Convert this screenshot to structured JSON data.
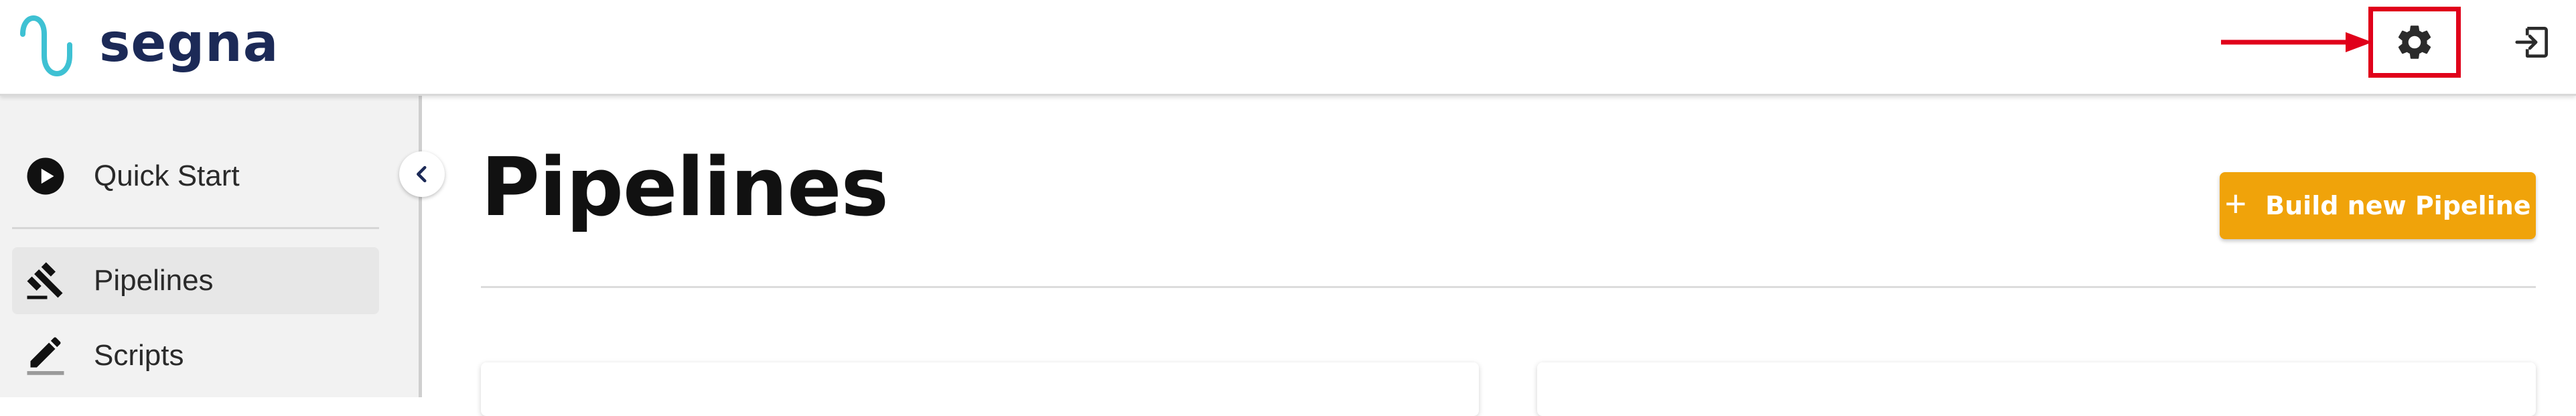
{
  "header": {
    "logo_text": "segna",
    "brand_color": "#1c2a57",
    "logo_accent_color": "#3ec1d3",
    "settings_icon": "gear-icon",
    "logout_icon": "logout-icon",
    "annotation_color": "#e0001a"
  },
  "sidebar": {
    "collapse_icon": "chevron-left-icon",
    "items": [
      {
        "label": "Quick Start",
        "icon": "play-circle-icon",
        "active": false
      },
      {
        "label": "Pipelines",
        "icon": "gavel-icon",
        "active": true
      },
      {
        "label": "Scripts",
        "icon": "pencil-icon",
        "active": false
      }
    ]
  },
  "main": {
    "title": "Pipelines",
    "build_button": {
      "label": "Build new Pipeline",
      "icon": "plus-icon",
      "color": "#f0a30a"
    }
  }
}
